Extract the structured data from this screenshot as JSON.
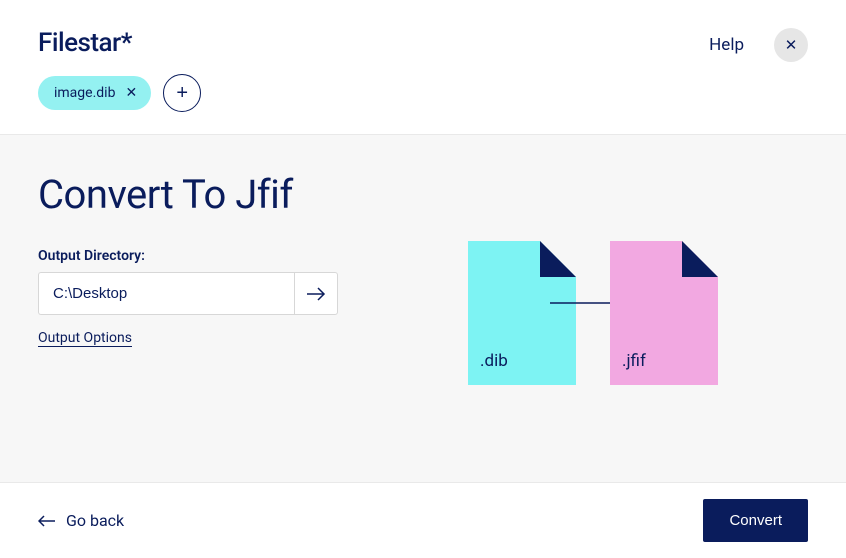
{
  "header": {
    "logo": "Filestar",
    "logo_suffix": "*",
    "help_label": "Help",
    "file_chip": "image.dib"
  },
  "main": {
    "title": "Convert To Jfif",
    "output_dir_label": "Output Directory:",
    "output_dir_value": "C:\\Desktop",
    "output_options_label": "Output Options",
    "source_ext": ".dib",
    "target_ext": ".jfif"
  },
  "footer": {
    "go_back_label": "Go back",
    "convert_label": "Convert"
  },
  "colors": {
    "primary": "#0a1c5c",
    "chip": "#94f1f1",
    "file_dib": "#7df3f3",
    "file_jfif": "#f2a8e1",
    "main_bg": "#f7f7f7"
  }
}
